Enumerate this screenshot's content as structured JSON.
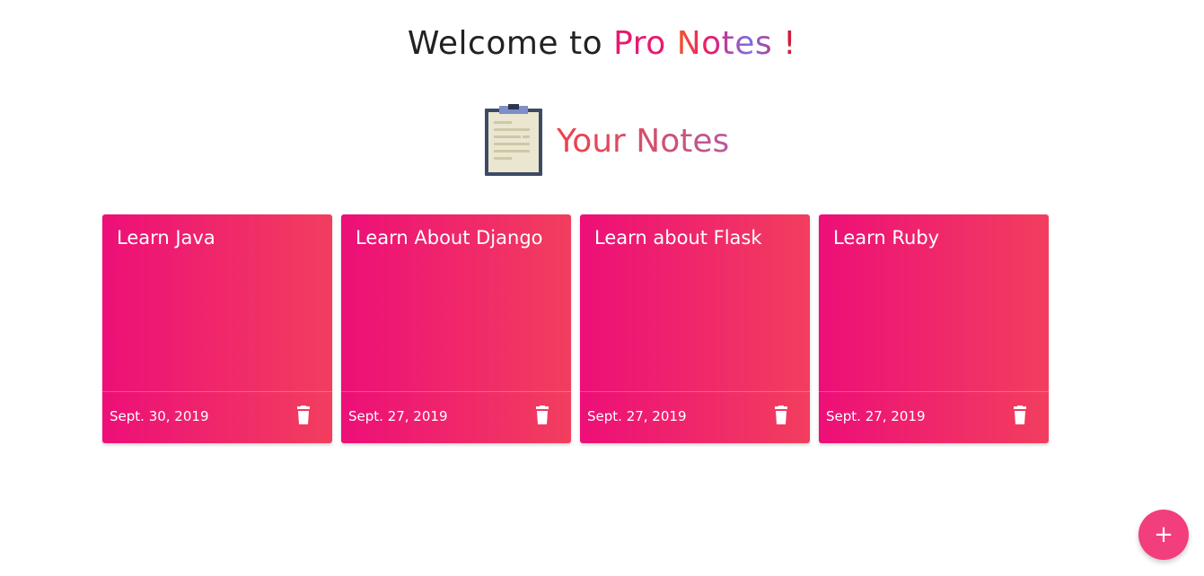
{
  "header": {
    "welcome_prefix": "Welcome to",
    "brand_pro": "Pro",
    "brand_notes": "Notes",
    "brand_bang": "!"
  },
  "notes_section": {
    "title": "Your Notes",
    "icon": "clipboard-icon"
  },
  "notes": [
    {
      "title": "Learn Java",
      "date": "Sept. 30, 2019"
    },
    {
      "title": "Learn About Django",
      "date": "Sept. 27, 2019"
    },
    {
      "title": "Learn about Flask",
      "date": "Sept. 27, 2019"
    },
    {
      "title": "Learn Ruby",
      "date": "Sept. 27, 2019"
    }
  ],
  "card_actions": {
    "delete_icon": "trash-icon"
  },
  "fab": {
    "label": "+",
    "icon": "plus-icon"
  },
  "colors": {
    "card_gradient_start": "#ed0f78",
    "card_gradient_end": "#f23e5e",
    "fab": "#f23e7d",
    "brand_pro": "#e8196f"
  }
}
